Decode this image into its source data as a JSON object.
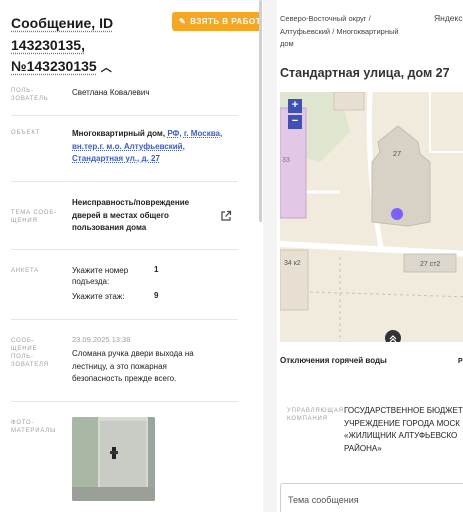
{
  "ticket": {
    "title_line1": "Сообщение, ID",
    "title_line2": "143230135,",
    "title_line3": "№143230135",
    "take_button": "ВЗЯТЬ В РАБОТУ"
  },
  "fields": {
    "user_label": "ПОЛЬ-ЗОВАТЕЛЬ",
    "user_value": "Светлана Ковалевич",
    "object_label": "ОБЪЕКТ",
    "object_prefix": "Многоквартирный дом,",
    "object_link": "РФ, г. Москва, вн.тер.г. м.о. Алтуфьевский, Стандартная ул., д. 27",
    "theme_label": "ТЕМА СООБ-ЩЕНИЯ",
    "theme_value": "Неисправность/повреждение дверей в местах общего пользования дома",
    "anketa_label": "АНКЕТА",
    "anketa_q1": "Укажите номер подъезда:",
    "anketa_a1": "1",
    "anketa_q2": "Укажите этаж:",
    "anketa_a2": "9",
    "msg_label": "СООБ-ЩЕНИЕ ПОЛЬ-ЗОВАТЕЛЯ",
    "msg_date": "23.09.2025 13:38",
    "msg_text": "Сломана ручка двери выхода на лестницу, а это пожарная безопасность прежде всего.",
    "photo_label": "ФОТО-МАТЕРИАЛЫ"
  },
  "right": {
    "breadcrumb": "Северо-Восточный округ / Алтуфьевский / Многоквартирный дом",
    "yandex": "Яндекс",
    "address": "Стандартная улица, дом 27",
    "map": {
      "zoom_in": "+",
      "zoom_out": "−",
      "label_27": "27",
      "label_33": "33",
      "label_34k2": "34 к2",
      "label_27c2": "27 ст2"
    },
    "outage_hot": "Отключения горячей воды",
    "outage_other": "Р",
    "uk_label": "УПРАВЛЯЮЩАЯ КОМПАНИЯ",
    "uk_value": "ГОСУДАРСТВЕННОЕ БЮДЖЕТ... УЧРЕЖДЕНИЕ ГОРОДА МОСК... «ЖИЛИЩНИК АЛТУФЬЕВСКО... РАЙОНА»",
    "uk_line1": "ГОСУДАРСТВЕННОЕ БЮДЖЕТ",
    "uk_line2": "УЧРЕЖДЕНИЕ ГОРОДА МОСК",
    "uk_line3": "«ЖИЛИЩНИК АЛТУФЬЕВСКО",
    "uk_line4": "РАЙОНА»",
    "topic_placeholder": "Тема сообщения"
  },
  "colors": {
    "accent_orange": "#f5a623",
    "link_blue": "#3b5bdb",
    "map_marker": "#7b61ff",
    "zoom_blue": "#3f51b5"
  }
}
